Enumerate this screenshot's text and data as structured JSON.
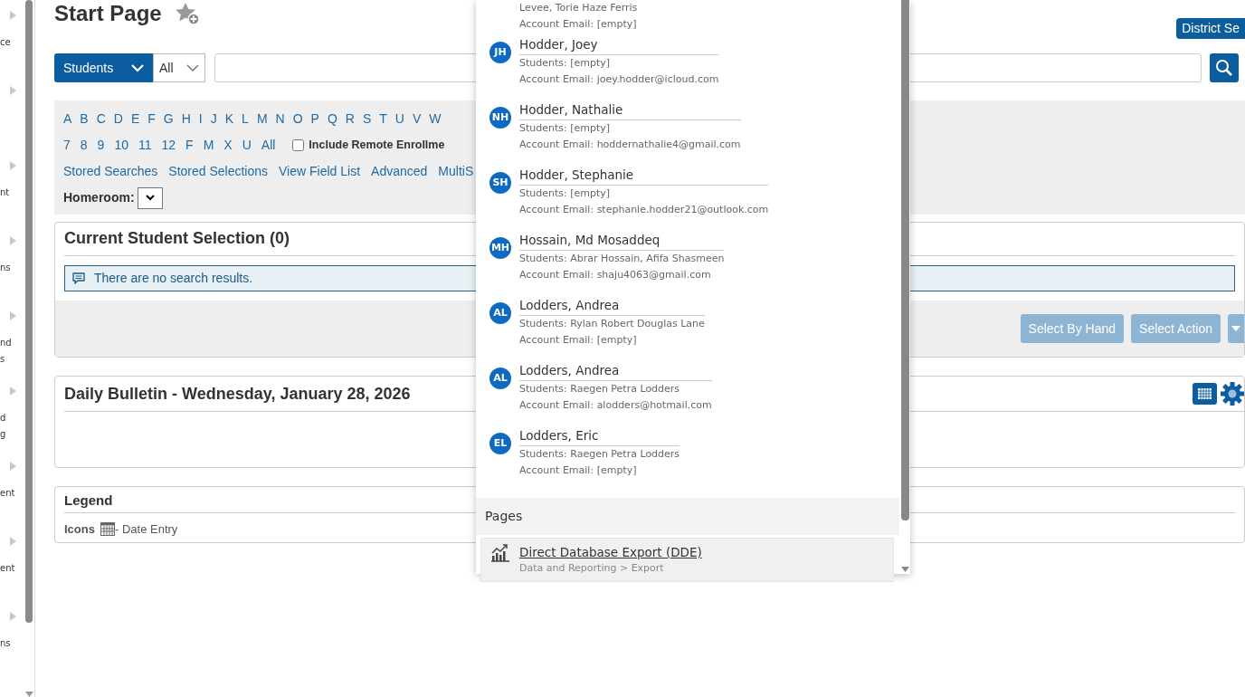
{
  "sidebar": {
    "items": [
      {
        "expandable": true,
        "lines": [
          "ce"
        ]
      },
      {
        "expandable": true
      },
      {
        "expandable": true,
        "lines": [
          "nt"
        ]
      },
      {
        "expandable": true,
        "lines": [
          "ns"
        ]
      },
      {
        "expandable": true,
        "lines": [
          "nd",
          "s"
        ]
      },
      {
        "expandable": true,
        "lines": [
          "d",
          "g"
        ]
      },
      {
        "expandable": true,
        "lines": [
          "ent"
        ]
      },
      {
        "expandable": true,
        "lines": [
          "ent"
        ]
      },
      {
        "expandable": true,
        "lines": [
          "ns"
        ]
      }
    ]
  },
  "page": {
    "title": "Start Page",
    "district_button": "District Se"
  },
  "search": {
    "scope": "Students",
    "filter": "All"
  },
  "letters": [
    "A",
    "B",
    "C",
    "D",
    "E",
    "F",
    "G",
    "H",
    "I",
    "J",
    "K",
    "L",
    "M",
    "N",
    "O",
    "P",
    "Q",
    "R",
    "S",
    "T",
    "U",
    "V",
    "W"
  ],
  "grades": [
    "7",
    "8",
    "9",
    "10",
    "11",
    "12",
    "F",
    "M",
    "X",
    "U",
    "All"
  ],
  "remote_checkbox": {
    "label": "Include Remote Enrollme",
    "checked": false
  },
  "links": [
    "Stored Searches",
    "Stored Selections",
    "View Field List",
    "Advanced",
    "MultiS"
  ],
  "homeroom": {
    "label": "Homeroom:"
  },
  "selection_panel": {
    "title": "Current Student Selection (0)",
    "message": "There are no search results.",
    "buttons": [
      {
        "label": "Select By Hand",
        "disabled": true
      },
      {
        "label": "Select Action",
        "disabled": true
      }
    ]
  },
  "bulletin": {
    "title": "Daily Bulletin - Wednesday, January 28, 2026"
  },
  "legend": {
    "title": "Legend",
    "label": "Icons",
    "entry": "- Date Entry"
  },
  "dropdown": {
    "contacts": [
      {
        "students": "Levee, Torie Haze Ferris",
        "email": "Account Email: [empty]"
      },
      {
        "initials": "JH",
        "name": "Hodder, Joey",
        "students": "Students: [empty]",
        "email": "Account Email: joey.hodder@icloud.com"
      },
      {
        "initials": "NH",
        "name": "Hodder, Nathalie",
        "students": "Students: [empty]",
        "email": "Account Email: hoddernathalie4@gmail.com"
      },
      {
        "initials": "SH",
        "name": "Hodder, Stephanie",
        "students": "Students: [empty]",
        "email": "Account Email: stephanie.hodder21@outlook.com"
      },
      {
        "initials": "MH",
        "name": "Hossain, Md Mosaddeq",
        "students": "Students: Abrar Hossain, Afifa Shasmeen",
        "email": "Account Email: shaju4063@gmail.com"
      },
      {
        "initials": "AL",
        "name": "Lodders, Andrea",
        "students": "Students: Rylan Robert Douglas Lane",
        "email": "Account Email: [empty]"
      },
      {
        "initials": "AL",
        "name": "Lodders, Andrea",
        "students": "Students: Raegen Petra Lodders",
        "email": "Account Email: alodders@hotmail.com"
      },
      {
        "initials": "EL",
        "name": "Lodders, Eric",
        "students": "Students: Raegen Petra Lodders",
        "email": "Account Email: [empty]"
      }
    ],
    "pages_heading": "Pages",
    "pages": [
      {
        "title": "Direct Database Export (DDE)",
        "path": "Data and Reporting > Export",
        "selected": true
      }
    ]
  }
}
